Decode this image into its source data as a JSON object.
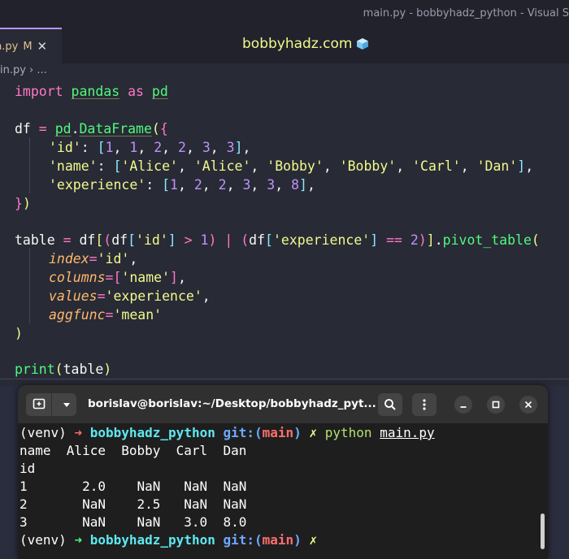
{
  "window": {
    "title": "main.py - bobbyhadz_python - Visual S"
  },
  "tab": {
    "file": "n.py",
    "modified": "M",
    "close": "✕"
  },
  "watermark": {
    "text": "bobbyhadz.com"
  },
  "breadcrumb": {
    "text": "in.py › ..."
  },
  "code": {
    "l1": {
      "kw": "import",
      "mod": "pandas",
      "as": "as",
      "alias": "pd"
    },
    "l3": {
      "var": "df",
      "eq": " = ",
      "pd": "pd",
      "dot": ".",
      "fn": "DataFrame",
      "open": "(",
      "brace": "{"
    },
    "l4": {
      "key": "'id'",
      "colon": ": ",
      "open": "[",
      "vals": [
        "1",
        "1",
        "2",
        "2",
        "3",
        "3"
      ],
      "close": "]",
      "trail": ","
    },
    "l5": {
      "key": "'name'",
      "colon": ": ",
      "open": "[",
      "vals": [
        "'Alice'",
        "'Alice'",
        "'Bobby'",
        "'Bobby'",
        "'Carl'",
        "'Dan'"
      ],
      "close": "]",
      "trail": ","
    },
    "l6": {
      "key": "'experience'",
      "colon": ": ",
      "open": "[",
      "vals": [
        "1",
        "2",
        "2",
        "3",
        "3",
        "8"
      ],
      "close": "]",
      "trail": ","
    },
    "l7": {
      "brace": "}",
      "paren": ")"
    },
    "l9": {
      "var": "table",
      "eq": " = ",
      "df": "df",
      "b1": "[",
      "p1": "(",
      "df2": "df",
      "b2": "[",
      "key1": "'id'",
      "b2c": "]",
      "gt": " > ",
      "n1": "1",
      "p1c": ")",
      "or": " | ",
      "p2": "(",
      "df3": "df",
      "b3": "[",
      "key2": "'experience'",
      "b3c": "]",
      "eqeq": " == ",
      "n2": "2",
      "p2c": ")",
      "b1c": "]",
      "dot": ".",
      "fn": "pivot_table",
      "open": "("
    },
    "l10": {
      "param": "index",
      "eq": "=",
      "val": "'id'",
      "comma": ","
    },
    "l11": {
      "param": "columns",
      "eq": "=",
      "open": "[",
      "val": "'name'",
      "close": "]",
      "comma": ","
    },
    "l12": {
      "param": "values",
      "eq": "=",
      "val": "'experience'",
      "comma": ","
    },
    "l13": {
      "param": "aggfunc",
      "eq": "=",
      "val": "'mean'"
    },
    "l14": {
      "paren": ")"
    },
    "l16": {
      "fn": "print",
      "open": "(",
      "arg": "table",
      "close": ")"
    }
  },
  "terminal": {
    "title": "borislav@borislav:~/Desktop/bobbyhadz_pyt...",
    "prompt": {
      "venv": "(venv) ",
      "arrow": "➜",
      "dir": "bobbyhadz_python",
      "git": "git:(",
      "branch": "main",
      "gitclose": ")",
      "x": "✗"
    },
    "command": {
      "cmd": "python",
      "arg": "main.py"
    },
    "output": [
      "name  Alice  Bobby  Carl  Dan",
      "id",
      "1       2.0    NaN   NaN  NaN",
      "2       NaN    2.5   NaN  NaN",
      "3       NaN    NaN   3.0  8.0"
    ]
  },
  "icons": {
    "new_tab": "new-tab-icon",
    "dropdown": "chevron-down-icon",
    "search": "search-icon",
    "menu": "kebab-menu-icon",
    "minimize": "minimize-icon",
    "maximize": "maximize-icon",
    "close": "close-icon",
    "cube": "cube-icon"
  },
  "colors": {
    "accent": "#bd93f9",
    "editor_bg": "#282a36",
    "terminal_bg": "#1e1e1e"
  }
}
